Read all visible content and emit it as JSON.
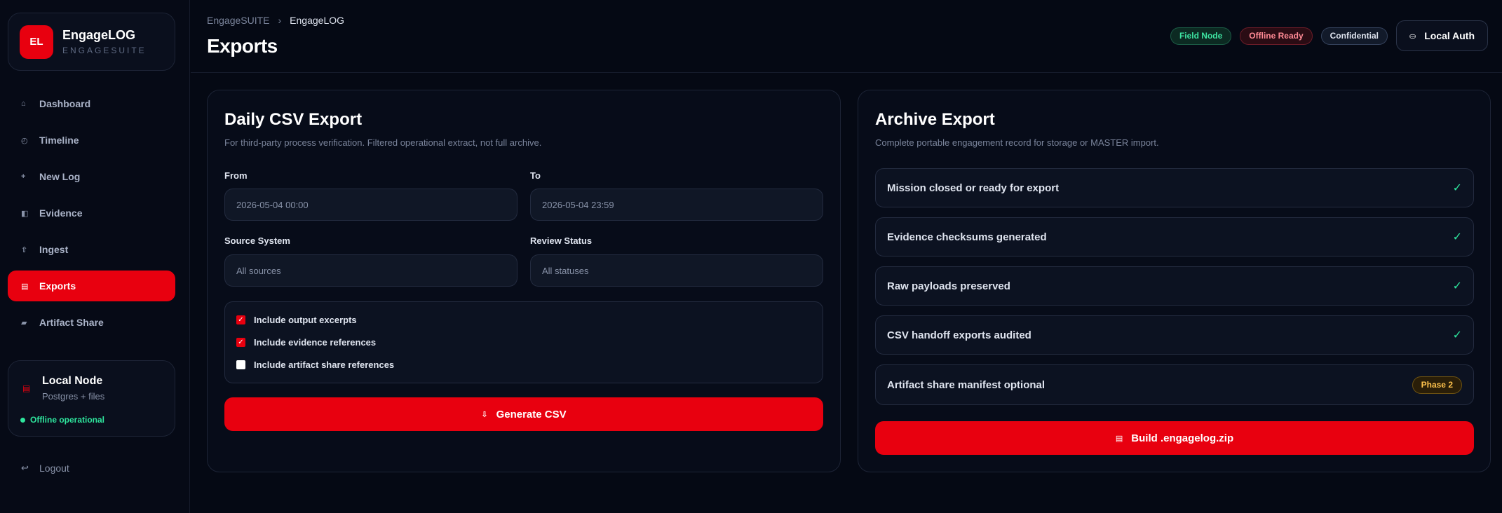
{
  "brand": {
    "logo": "EL",
    "name": "EngageLOG",
    "suite": "ENGAGESUITE"
  },
  "nav": [
    {
      "icon": "⌂",
      "icon_name": "home-icon",
      "label": "Dashboard"
    },
    {
      "icon": "◴",
      "icon_name": "clock-icon",
      "label": "Timeline"
    },
    {
      "icon": "+",
      "icon_name": "plus-icon",
      "label": "New Log"
    },
    {
      "icon": "◧",
      "icon_name": "evidence-icon",
      "label": "Evidence"
    },
    {
      "icon": "⇧",
      "icon_name": "upload-icon",
      "label": "Ingest"
    },
    {
      "icon": "▤",
      "icon_name": "export-icon",
      "label": "Exports",
      "active": true
    },
    {
      "icon": "▰",
      "icon_name": "share-icon",
      "label": "Artifact Share"
    }
  ],
  "node": {
    "icon": "▤",
    "title": "Local Node",
    "sub": "Postgres + files",
    "status": "Offline operational"
  },
  "logout": {
    "icon": "↩",
    "label": "Logout"
  },
  "header": {
    "crumb_root": "EngageSUITE",
    "crumb_sep": "›",
    "crumb_current": "EngageLOG",
    "title": "Exports",
    "badges": [
      "Field Node",
      "Offline Ready",
      "Confidential"
    ],
    "auth_icon": "⛀",
    "auth_label": "Local Auth"
  },
  "csv": {
    "title": "Daily CSV Export",
    "subtitle": "For third-party process verification. Filtered operational extract, not full archive.",
    "from_label": "From",
    "from_value": "2026-05-04 00:00",
    "to_label": "To",
    "to_value": "2026-05-04 23:59",
    "source_label": "Source System",
    "source_value": "All sources",
    "review_label": "Review Status",
    "review_value": "All statuses",
    "options": [
      {
        "label": "Include output excerpts",
        "checked": true
      },
      {
        "label": "Include evidence references",
        "checked": true
      },
      {
        "label": "Include artifact share references",
        "checked": false
      }
    ],
    "button_icon": "⇩",
    "button_label": "Generate CSV"
  },
  "archive": {
    "title": "Archive Export",
    "subtitle": "Complete portable engagement record for storage or MASTER import.",
    "checks": [
      {
        "label": "Mission closed or ready for export",
        "status": "✓"
      },
      {
        "label": "Evidence checksums generated",
        "status": "✓"
      },
      {
        "label": "Raw payloads preserved",
        "status": "✓"
      },
      {
        "label": "CSV handoff exports audited",
        "status": "✓"
      },
      {
        "label": "Artifact share manifest optional",
        "badge": "Phase 2"
      }
    ],
    "button_icon": "▤",
    "button_label": "Build .engagelog.zip"
  },
  "colors": {
    "accent": "#e8000f",
    "success": "#2ee59d",
    "background": "#050914"
  }
}
